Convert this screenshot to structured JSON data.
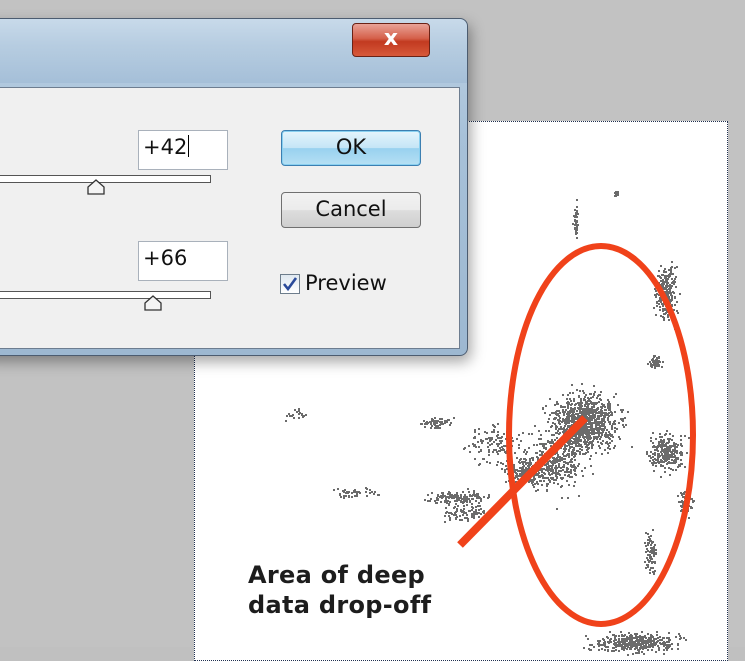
{
  "dialog": {
    "close_label": "x",
    "field_1_value": "+42",
    "field_2_value": "+66",
    "slider_1_percent": 48,
    "slider_2_percent": 74,
    "ok_label": "OK",
    "cancel_label": "Cancel",
    "preview_label": "Preview",
    "preview_checked": true
  },
  "canvas": {
    "callout_line_1": "Area of deep",
    "callout_line_2": "data drop-off",
    "callout_color": "#f0421a"
  },
  "colors": {
    "workspace": "#c2c2c2",
    "stipple": "#6b6b6b"
  },
  "icons": [
    "close-icon",
    "checkmark-icon",
    "slider-thumb-icon"
  ]
}
